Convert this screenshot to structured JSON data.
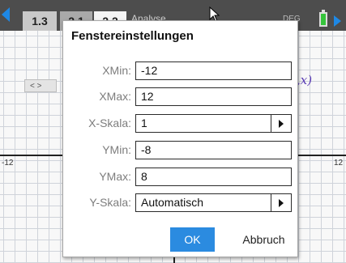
{
  "topbar": {
    "tabs": [
      "1.3",
      "2.1",
      "2.2"
    ],
    "title": "Analyse",
    "mode": "DEG"
  },
  "graph": {
    "x_min_label": "-12",
    "x_max_label": "12",
    "function_label": ",x)",
    "mini_nav": "< >"
  },
  "dialog": {
    "title": "Fenstereinstellungen",
    "fields": [
      {
        "label": "XMin:",
        "value": "-12"
      },
      {
        "label": "XMax:",
        "value": "12"
      },
      {
        "label": "X-Skala:",
        "value": "1"
      },
      {
        "label": "YMin:",
        "value": "-8"
      },
      {
        "label": "YMax:",
        "value": "8"
      },
      {
        "label": "Y-Skala:",
        "value": "Automatisch"
      }
    ],
    "ok_label": "OK",
    "cancel_label": "Abbruch"
  },
  "colors": {
    "accent": "#2b8be0",
    "battery": "#35c43b",
    "function": "#5b3db5"
  }
}
